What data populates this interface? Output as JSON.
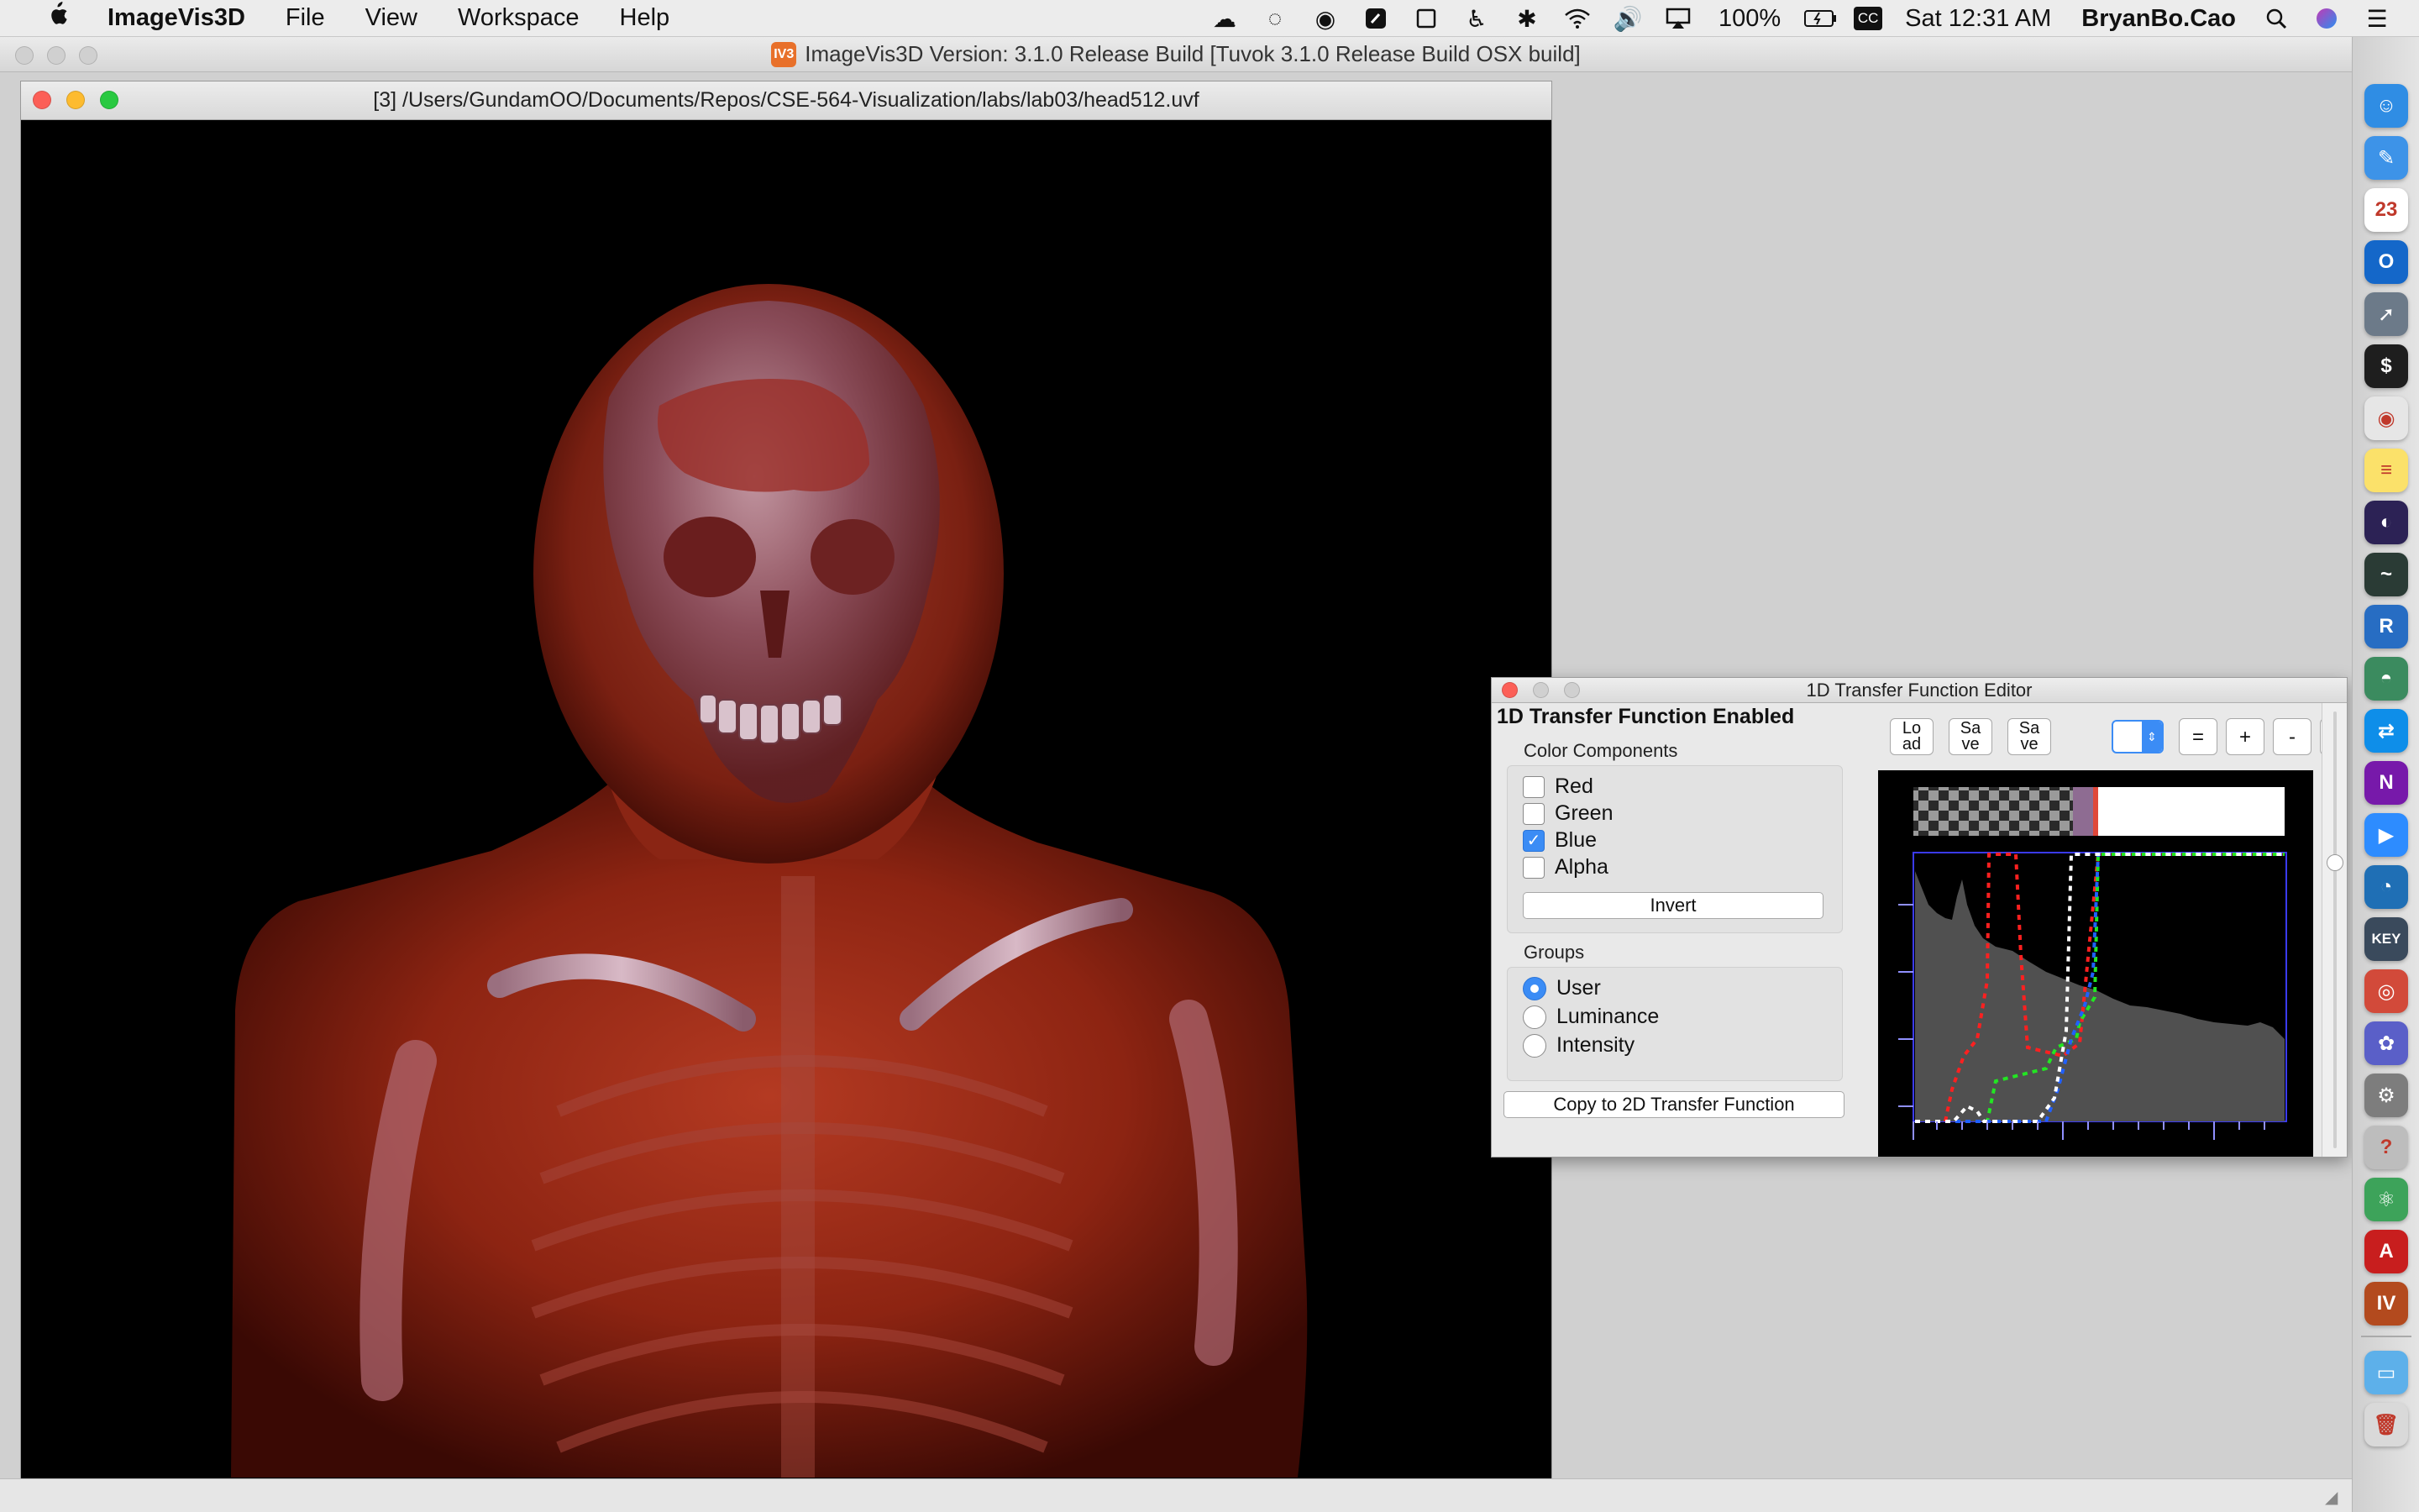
{
  "menubar": {
    "apple": "",
    "app_name": "ImageVis3D",
    "items": [
      "File",
      "View",
      "Workspace",
      "Help"
    ],
    "battery": "100%",
    "clock": "Sat 12:31 AM",
    "user": "BryanBo.Cao",
    "cc_badge": "CC"
  },
  "app_window": {
    "title": "ImageVis3D Version: 3.1.0 Release Build [Tuvok 3.1.0 Release Build OSX build]",
    "badge": "IV3"
  },
  "render_window": {
    "title": "[3] /Users/GundamOO/Documents/Repos/CSE-564-Visualization/labs/lab03/head512.uvf"
  },
  "tf_editor": {
    "title": "1D Transfer Function Editor",
    "enabled_label": "1D Transfer Function Enabled",
    "color_components_label": "Color Components",
    "components": [
      {
        "label": "Red",
        "checked": false
      },
      {
        "label": "Green",
        "checked": false
      },
      {
        "label": "Blue",
        "checked": true
      },
      {
        "label": "Alpha",
        "checked": false
      }
    ],
    "invert_label": "Invert",
    "groups_label": "Groups",
    "groups": [
      {
        "label": "User",
        "selected": true
      },
      {
        "label": "Luminance",
        "selected": false
      },
      {
        "label": "Intensity",
        "selected": false
      }
    ],
    "copy_label": "Copy to 2D Transfer Function",
    "toolbar": {
      "load_label": "Lo ad",
      "save1_label": "Sa ve",
      "save2_label": "Sa ve",
      "equal_label": "=",
      "plus_label": "+",
      "minus_label": "-",
      "more_label": "..."
    }
  },
  "dock": {
    "icons": [
      {
        "name": "finder-icon",
        "color": "#2f8de4",
        "glyph": "☺"
      },
      {
        "name": "safari-pen-icon",
        "color": "#3d93e8",
        "glyph": "✎"
      },
      {
        "name": "calendar-icon",
        "color": "#ffffff",
        "glyph": "23"
      },
      {
        "name": "outlook-icon",
        "color": "#1467c9",
        "glyph": "O"
      },
      {
        "name": "launchpad-icon",
        "color": "#6c7a89",
        "glyph": "➚"
      },
      {
        "name": "terminal-icon",
        "color": "#1e1e1e",
        "glyph": "$"
      },
      {
        "name": "chrome-icon",
        "color": "#e6e6e6",
        "glyph": "◉"
      },
      {
        "name": "notes-icon",
        "color": "#fbe16a",
        "glyph": "≡"
      },
      {
        "name": "eclipse-icon",
        "color": "#2c2255",
        "glyph": "◐"
      },
      {
        "name": "activity-monitor-icon",
        "color": "#2a3b35",
        "glyph": "~"
      },
      {
        "name": "r-icon",
        "color": "#276dc3",
        "glyph": "R"
      },
      {
        "name": "webstorm-icon",
        "color": "#3b8b5f",
        "glyph": "◓"
      },
      {
        "name": "teamviewer-icon",
        "color": "#0e8ee9",
        "glyph": "⇄"
      },
      {
        "name": "onenote-icon",
        "color": "#7719aa",
        "glyph": "N"
      },
      {
        "name": "zoom-icon",
        "color": "#2d8cff",
        "glyph": "▶"
      },
      {
        "name": "browser-icon",
        "color": "#1f6fb5",
        "glyph": "◔"
      },
      {
        "name": "keynote-icon",
        "color": "#3a4a5c",
        "glyph": "KEY"
      },
      {
        "name": "disk-utility-icon",
        "color": "#d24a3a",
        "glyph": "◎"
      },
      {
        "name": "color-icon",
        "color": "#5a5fc8",
        "glyph": "✿"
      },
      {
        "name": "system-preferences-icon",
        "color": "#7d7d7d",
        "glyph": "⚙"
      },
      {
        "name": "help-icon",
        "color": "#bdbdbd",
        "glyph": "?"
      },
      {
        "name": "atom-icon",
        "color": "#3da35a",
        "glyph": "⚛"
      },
      {
        "name": "acrobat-icon",
        "color": "#c81e1e",
        "glyph": "A"
      },
      {
        "name": "imagevis3d-icon",
        "color": "#b34a1e",
        "glyph": "IV"
      },
      {
        "name": "folder-icon",
        "color": "#5db0ea",
        "glyph": "▭"
      },
      {
        "name": "trash-icon",
        "color": "#d9d9d9",
        "glyph": "🗑"
      }
    ]
  }
}
